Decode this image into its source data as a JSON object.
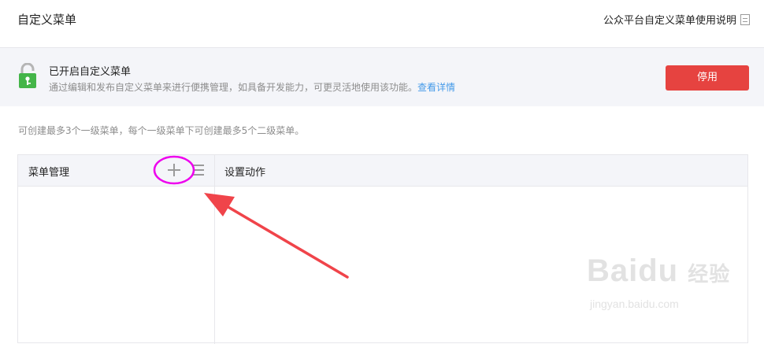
{
  "header": {
    "title": "自定义菜单",
    "help_link": "公众平台自定义菜单使用说明"
  },
  "banner": {
    "status_title": "已开启自定义菜单",
    "description": "通过编辑和发布自定义菜单来进行便携管理，如具备开发能力，可更灵活地使用该功能。",
    "detail_link": "查看详情",
    "disable_button": "停用"
  },
  "tip": "可创建最多3个一级菜单，每个一级菜单下可创建最多5个二级菜单。",
  "panel": {
    "menu_management_label": "菜单管理",
    "action_settings_label": "设置动作"
  },
  "watermark": {
    "logo_text": "Bai",
    "logo_suffix": "du",
    "logo_cn": "经验",
    "url": "jingyan.baidu.com"
  },
  "colors": {
    "accent_red": "#e64340",
    "lock_green": "#44b549",
    "link_blue": "#459ae9",
    "annotation_magenta": "#ee00ee",
    "annotation_arrow": "#f0444a"
  }
}
